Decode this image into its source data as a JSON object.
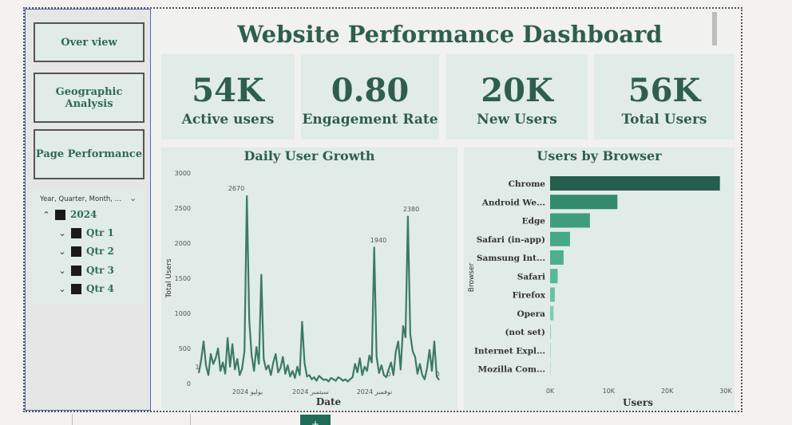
{
  "nav": {
    "overview": "Over view",
    "geographic": "Geographic Analysis",
    "page_performance": "Page Performance"
  },
  "slicer": {
    "header": "Year, Quarter, Month, ...",
    "year": "2024",
    "quarters": [
      "Qtr 1",
      "Qtr 2",
      "Qtr 3",
      "Qtr 4"
    ]
  },
  "title": "Website  Performance Dashboard",
  "kpis": [
    {
      "value": "54K",
      "label": "Active users"
    },
    {
      "value": "0.80",
      "label": "Engagement Rate"
    },
    {
      "value": "20K",
      "label": "New Users"
    },
    {
      "value": "56K",
      "label": "Total Users"
    }
  ],
  "icons": {
    "collapse": "chevron-up-icon",
    "expand": "chevron-down-icon",
    "add_page": "plus-icon"
  },
  "colors": {
    "accent": "#2e5e4e",
    "panel": "#e1ebe8",
    "line": "#3c7a64",
    "bar_dark": "#1f5e4c"
  },
  "chart_data": [
    {
      "type": "line",
      "title": "Daily User Growth",
      "xlabel": "Date",
      "ylabel": "Total Users",
      "ylim": [
        0,
        3000
      ],
      "yticks": [
        "0",
        "500",
        "1000",
        "1500",
        "2000",
        "2500",
        "3000"
      ],
      "xticks": [
        "2024 يوليو",
        "2024 سبتمبر",
        "2024 نوفمبر"
      ],
      "annotations": [
        "2670",
        "1940",
        "2380",
        "1",
        "0",
        "0"
      ],
      "grid": false,
      "series": [
        {
          "values": [
            150,
            340,
            600,
            260,
            120,
            420,
            280,
            360,
            500,
            180,
            300,
            140,
            650,
            240,
            560,
            200,
            350,
            120,
            210,
            460,
            2670,
            900,
            400,
            180,
            520,
            280,
            1550,
            350,
            200,
            260,
            120,
            300,
            420,
            160,
            220,
            380,
            140,
            260,
            100,
            180,
            80,
            240,
            120,
            880,
            300,
            100,
            120,
            60,
            90,
            40,
            110,
            80,
            50,
            60,
            30,
            80,
            60,
            40,
            90,
            70,
            40,
            60,
            30,
            60,
            90,
            280,
            160,
            360,
            120,
            240,
            180,
            400,
            300,
            1940,
            380,
            150,
            260,
            120,
            90,
            200,
            300,
            120,
            460,
            600,
            200,
            820,
            660,
            2380,
            700,
            460,
            380,
            140,
            280,
            120,
            60,
            220,
            480,
            180,
            600,
            100,
            50
          ]
        }
      ]
    },
    {
      "type": "bar",
      "orientation": "horizontal",
      "title": "Users by Browser",
      "xlabel": "Users",
      "ylabel": "Browser",
      "xlim": [
        0,
        30000
      ],
      "xticks": [
        "0K",
        "10K",
        "20K",
        "30K"
      ],
      "categories": [
        "Chrome",
        "Android We...",
        "Edge",
        "Safari (in-app)",
        "Samsung Int...",
        "Safari",
        "Firefox",
        "Opera",
        "(not set)",
        "Internet Expl...",
        "Mozilla Com..."
      ],
      "values": [
        29000,
        11500,
        6800,
        3400,
        2300,
        1300,
        800,
        600,
        100,
        60,
        40
      ],
      "colors": [
        "#255e4c",
        "#348a6c",
        "#3f9d7c",
        "#45a886",
        "#4cb08e",
        "#59b897",
        "#6ac1a2",
        "#80cbb1",
        "#94d4bd",
        "#a8dcc9",
        "#bbe4d5"
      ]
    }
  ]
}
